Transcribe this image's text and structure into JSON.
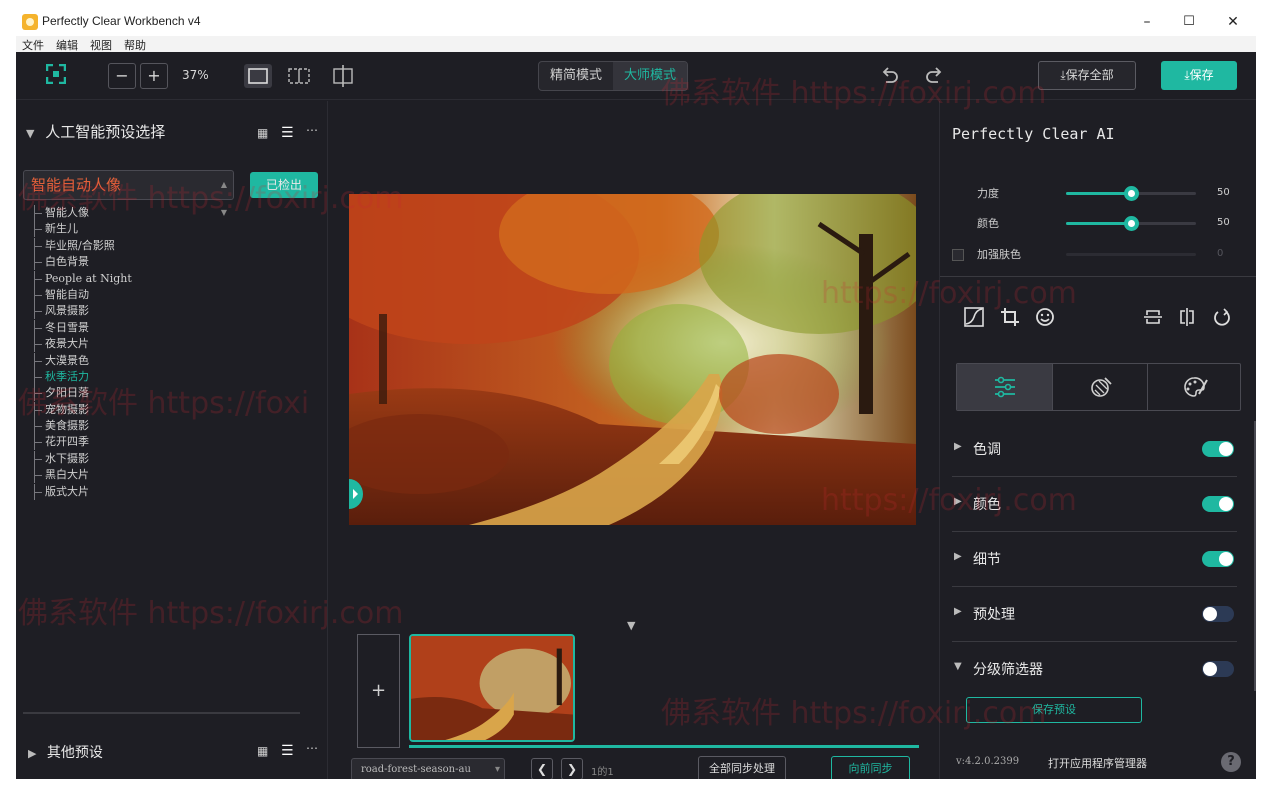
{
  "window": {
    "title": "Perfectly Clear Workbench v4",
    "min": "–",
    "max": "☐",
    "close": "✕"
  },
  "menu": [
    "文件",
    "编辑",
    "视图",
    "帮助"
  ],
  "toolbar": {
    "zoom_minus": "−",
    "zoom_plus": "+",
    "zoom_level": "37%",
    "mode_simple": "精简模式",
    "mode_master": "大师模式",
    "save_all": "保存全部",
    "save": "保存"
  },
  "left": {
    "header": "人工智能预设选择",
    "selected_preset": "智能自动人像",
    "detected_button": "已检出",
    "presets": [
      {
        "label": "智能人像",
        "active": false
      },
      {
        "label": "新生儿",
        "active": false
      },
      {
        "label": "毕业照/合影照",
        "active": false
      },
      {
        "label": "白色背景",
        "active": false
      },
      {
        "label": "People at Night",
        "active": false
      },
      {
        "label": "智能自动",
        "active": false
      },
      {
        "label": "风景摄影",
        "active": false
      },
      {
        "label": "冬日雪景",
        "active": false
      },
      {
        "label": "夜景大片",
        "active": false
      },
      {
        "label": "大漠景色",
        "active": false
      },
      {
        "label": "秋季活力",
        "active": true
      },
      {
        "label": "夕阳日落",
        "active": false
      },
      {
        "label": "宠物摄影",
        "active": false
      },
      {
        "label": "美食摄影",
        "active": false
      },
      {
        "label": "花开四季",
        "active": false
      },
      {
        "label": "水下摄影",
        "active": false
      },
      {
        "label": "黑白大片",
        "active": false
      },
      {
        "label": "版式大片",
        "active": false
      }
    ],
    "other_header": "其他预设"
  },
  "canvas": {
    "add_label": "+",
    "filename": "road-forest-season-au",
    "page_info": "1的1",
    "sync_all": "全部同步处理",
    "sync_forward": "向前同步"
  },
  "right": {
    "ai_title": "Perfectly Clear AI",
    "sliders": [
      {
        "label": "力度",
        "value": 50,
        "enabled": true
      },
      {
        "label": "颜色",
        "value": 50,
        "enabled": true
      },
      {
        "label": "加强肤色",
        "value": 0,
        "enabled": false
      }
    ],
    "sections": [
      {
        "label": "色调",
        "on": true,
        "expanded": false
      },
      {
        "label": "颜色",
        "on": true,
        "expanded": false
      },
      {
        "label": "细节",
        "on": true,
        "expanded": false
      },
      {
        "label": "预处理",
        "on": false,
        "expanded": false
      },
      {
        "label": "分级筛选器",
        "on": false,
        "expanded": true
      }
    ],
    "save_preset": "保存预设",
    "version": "v:4.2.0.2399",
    "app_manager": "打开应用程序管理器",
    "help": "?"
  },
  "watermarks": [
    "佛系软件 https://foxirj.com",
    "佛系软件 https://foxirj.com",
    "佛系软件 https://foxi",
    "佛系软件 https://foxirj.com",
    "https://foxirj.com",
    "https://foxirj.com",
    "佛系软件 https://foxirj.com"
  ],
  "colors": {
    "accent": "#1fb8a1",
    "preset_highlight": "#e4613a",
    "background": "#1e1e24"
  }
}
